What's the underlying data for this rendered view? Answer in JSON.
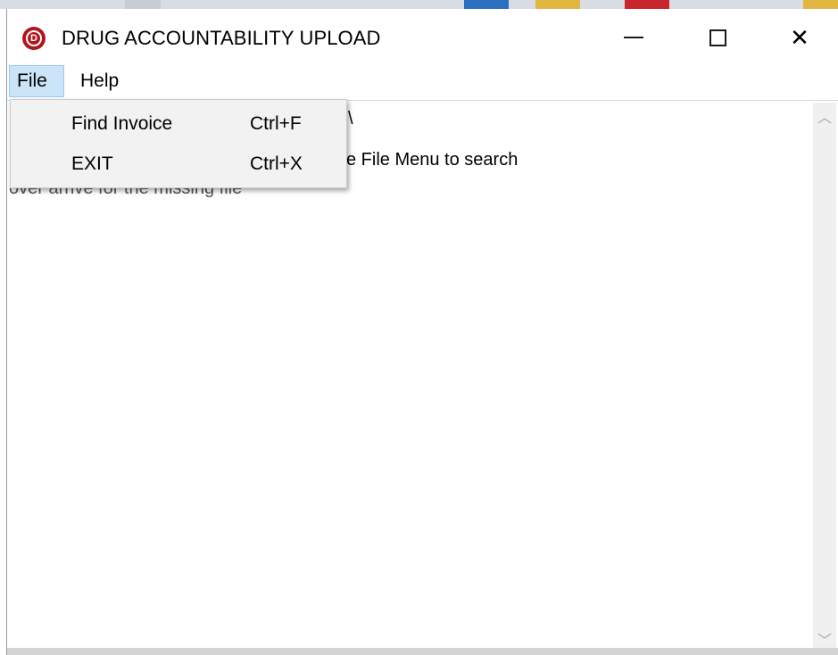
{
  "window": {
    "title": "DRUG ACCOUNTABILITY UPLOAD",
    "app_icon_letter": "D",
    "accent_color": "#b0161e"
  },
  "titlebar_buttons": {
    "minimize_icon": "minimize-icon",
    "maximize_icon": "maximize-icon",
    "close_glyph": "✕"
  },
  "menubar": {
    "file_label": "File",
    "help_label": "Help"
  },
  "file_menu": {
    "items": [
      {
        "label": "Find Invoice",
        "shortcut": "Ctrl+F"
      },
      {
        "label": "EXIT",
        "shortcut": "Ctrl+X"
      }
    ]
  },
  "content": {
    "line1": "\\",
    "line2": "e File Menu to search",
    "line3": "over arrive for the missing file"
  },
  "scrollbar": {
    "up_glyph": "︿",
    "down_glyph": "﹀"
  }
}
